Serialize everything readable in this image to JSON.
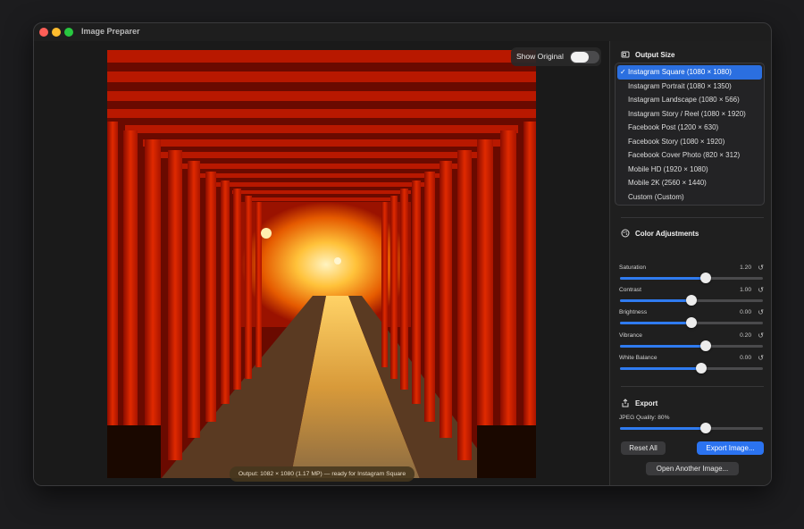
{
  "window": {
    "title": "Image Preparer"
  },
  "canvas": {
    "show_original_label": "Show Original",
    "show_original_on": false,
    "status": "Output: 1082 × 1080 (1.17 MP) — ready for Instagram Square"
  },
  "output_size": {
    "heading": "Output Size",
    "selected_index": 0,
    "options": [
      "Instagram Square (1080 × 1080)",
      "Instagram Portrait (1080 × 1350)",
      "Instagram Landscape (1080 × 566)",
      "Instagram Story / Reel (1080 × 1920)",
      "Facebook Post (1200 × 630)",
      "Facebook Story (1080 × 1920)",
      "Facebook Cover Photo (820 × 312)",
      "Mobile HD (1920 × 1080)",
      "Mobile 2K (2560 × 1440)",
      "Custom (Custom)"
    ]
  },
  "color_adjustments": {
    "heading": "Color Adjustments",
    "sliders": [
      {
        "label": "Saturation",
        "value_text": "1.20",
        "fraction": 0.6
      },
      {
        "label": "Contrast",
        "value_text": "1.00",
        "fraction": 0.5
      },
      {
        "label": "Brightness",
        "value_text": "0.00",
        "fraction": 0.5
      },
      {
        "label": "Vibrance",
        "value_text": "0.20",
        "fraction": 0.6
      },
      {
        "label": "White Balance",
        "value_text": "0.00",
        "fraction": 0.57
      }
    ]
  },
  "export": {
    "heading": "Export",
    "quality_label": "JPEG Quality: 80%",
    "quality_fraction": 0.6,
    "reset_label": "Reset All",
    "export_label": "Export Image...",
    "open_label": "Open Another Image..."
  },
  "colors": {
    "accent": "#2b6fe0",
    "torii": "#c81e00",
    "glow": "#ffb02a"
  },
  "icons": [
    "crop-icon",
    "palette-icon",
    "share-icon",
    "reset-arrow-icon",
    "checkmark-icon"
  ]
}
